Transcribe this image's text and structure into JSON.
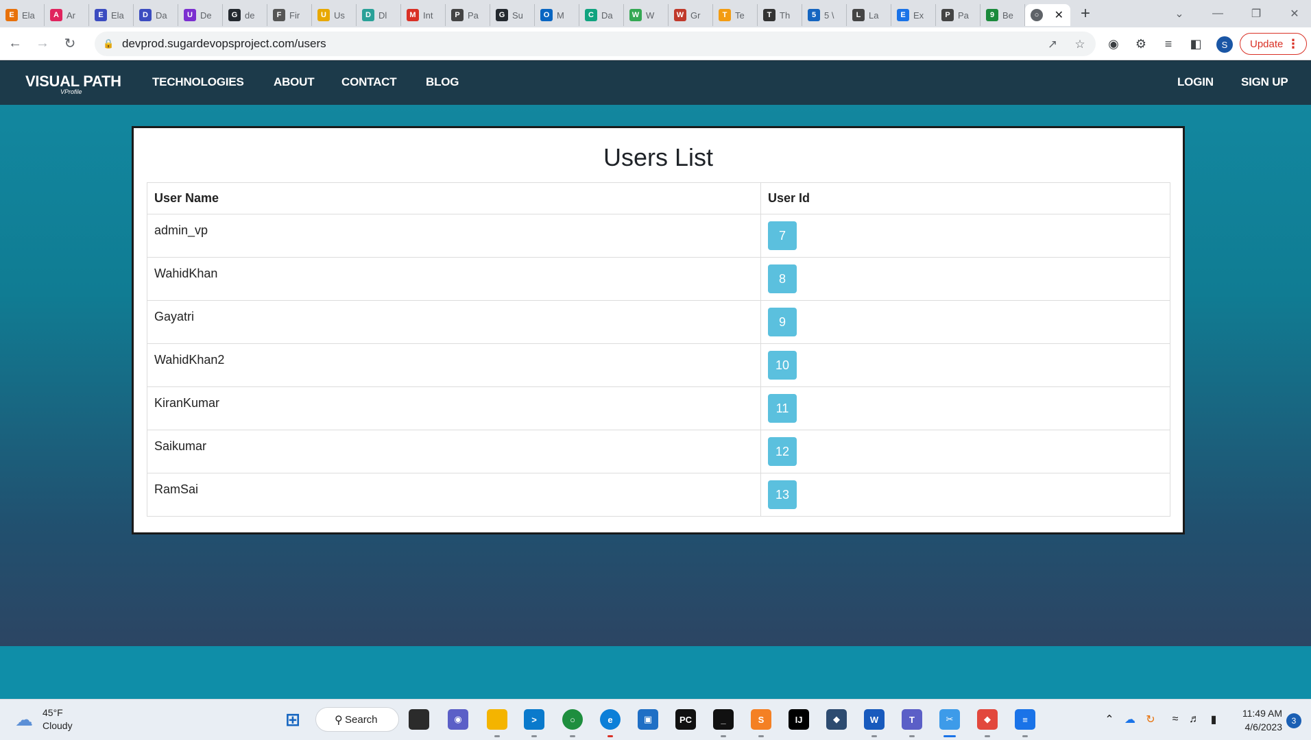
{
  "browser": {
    "tabs": [
      {
        "label": "Ela",
        "color": "#e8710a",
        "glyph": "E"
      },
      {
        "label": "Ar",
        "color": "#e0245e",
        "glyph": "A"
      },
      {
        "label": "Ela",
        "color": "#3b4cc0",
        "glyph": "E"
      },
      {
        "label": "Da",
        "color": "#3b4cc0",
        "glyph": "D"
      },
      {
        "label": "De",
        "color": "#7b2fd0",
        "glyph": "U"
      },
      {
        "label": "de",
        "color": "#24292f",
        "glyph": "G"
      },
      {
        "label": "Fir",
        "color": "#555555",
        "glyph": "F"
      },
      {
        "label": "Us",
        "color": "#e8a800",
        "glyph": "U"
      },
      {
        "label": "Dl",
        "color": "#2aa198",
        "glyph": "D"
      },
      {
        "label": "Int",
        "color": "#d93025",
        "glyph": "M"
      },
      {
        "label": "Pa",
        "color": "#444444",
        "glyph": "P"
      },
      {
        "label": "Su",
        "color": "#24292f",
        "glyph": "G"
      },
      {
        "label": "M",
        "color": "#0a66c2",
        "glyph": "O"
      },
      {
        "label": "Da",
        "color": "#10a37f",
        "glyph": "C"
      },
      {
        "label": "W",
        "color": "#34a853",
        "glyph": "W"
      },
      {
        "label": "Gr",
        "color": "#c0392b",
        "glyph": "W"
      },
      {
        "label": "Te",
        "color": "#f39c12",
        "glyph": "T"
      },
      {
        "label": "Th",
        "color": "#333333",
        "glyph": "T"
      },
      {
        "label": "5 \\",
        "color": "#1565c0",
        "glyph": "5"
      },
      {
        "label": "La",
        "color": "#444444",
        "glyph": "L"
      },
      {
        "label": "Ex",
        "color": "#1a73e8",
        "glyph": "E"
      },
      {
        "label": "Pa",
        "color": "#444444",
        "glyph": "P"
      },
      {
        "label": "Be",
        "color": "#1b8a3c",
        "glyph": "9"
      }
    ],
    "active_tab_icon": "globe-icon",
    "address": "devprod.sugardevopsproject.com/users",
    "update_label": "Update",
    "profile_initial": "S"
  },
  "site": {
    "brand": "VISUAL PATH",
    "brand_sub": "VProfile",
    "nav_left": [
      "TECHNOLOGIES",
      "ABOUT",
      "CONTACT",
      "BLOG"
    ],
    "nav_right": [
      "LOGIN",
      "SIGN UP"
    ]
  },
  "users_list": {
    "title": "Users List",
    "headers": {
      "name": "User Name",
      "id": "User Id"
    },
    "rows": [
      {
        "name": "admin_vp",
        "id": "7"
      },
      {
        "name": "WahidKhan",
        "id": "8"
      },
      {
        "name": "Gayatri",
        "id": "9"
      },
      {
        "name": "WahidKhan2",
        "id": "10"
      },
      {
        "name": "KiranKumar",
        "id": "11"
      },
      {
        "name": "Saikumar",
        "id": "12"
      },
      {
        "name": "RamSai",
        "id": "13"
      }
    ],
    "badge_color": "#5bc0de"
  },
  "taskbar": {
    "weather_temp": "45°F",
    "weather_desc": "Cloudy",
    "search_label": "Search",
    "time": "11:49 AM",
    "date": "4/6/2023",
    "notification_count": "3"
  }
}
